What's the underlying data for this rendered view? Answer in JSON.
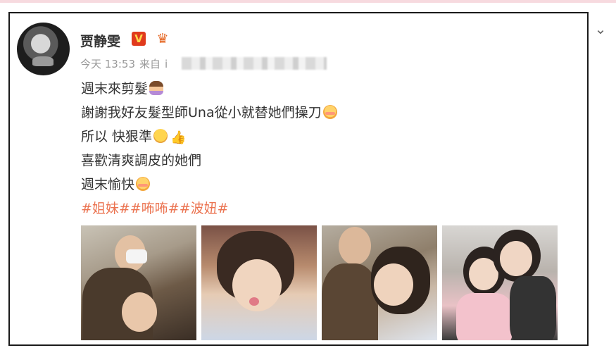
{
  "post": {
    "author": "贾静雯",
    "verified_badge": "V",
    "crown_badge": "♛",
    "time": "今天 13:53",
    "source_prefix": "来自",
    "source_char": "i",
    "lines": [
      "週末來剪髮",
      "謝謝我好友髮型師Una從小就替她們操刀",
      "所以 快狠準",
      "喜歡清爽調皮的她們",
      "週末愉快"
    ],
    "hashtags": [
      "#姐妹#",
      "#咘咘#",
      "#波妞#"
    ],
    "more_icon": "chevron-down-icon",
    "thumb_glyph": "👍",
    "photos": [
      "photo-1",
      "photo-2",
      "photo-3",
      "photo-4"
    ]
  },
  "colors": {
    "hashtag": "#eb7350",
    "verified": "#e03a1d",
    "border": "#1a1a1a"
  }
}
